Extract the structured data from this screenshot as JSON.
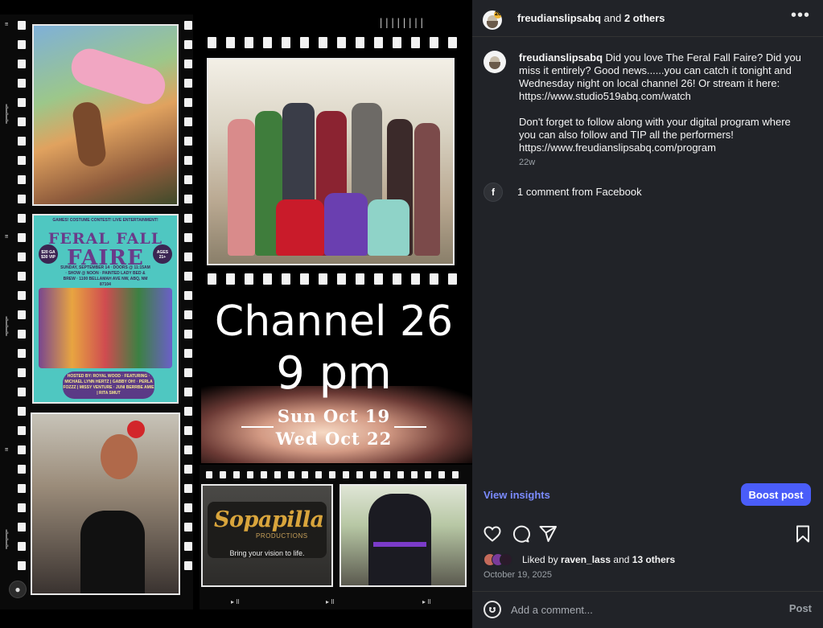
{
  "media": {
    "poster": {
      "header_line": "GAMES! COSTUME CONTEST! LIVE ENTERTAINMENT!",
      "title_line1": "FERAL FALL",
      "title_line2": "FAIRE",
      "price_badge": "$20 GA $30 VIP",
      "age_badge": "AGES 21+",
      "info": "SUNDAY, SEPTEMBER 14 · DOORS @ 11:15AM · SHOW @ NOON · PAINTED LADY BED & BREW · 1100 BELLAMAH AVE NW, ABQ, NM 87104",
      "host": "HOSTED BY: ROYAL WOOD · FEATURING · MICHAEL LYNN HERTZ | GABBY OH! · PERLA FOZZZ | MISSY VENTURE · JUNI BERRBE AMIE | RITA SMUT"
    },
    "channel_title": "Channel 26",
    "time": "9 pm",
    "date1": "Sun Oct 19",
    "date2": "Wed Oct 22",
    "logo_name": "Sopapilla",
    "logo_sub": "PRODUCTIONS",
    "logo_tagline": "Bring your vision to life."
  },
  "header": {
    "username": "freudianslipsabq",
    "and_text": " and ",
    "others": "2 others",
    "more_icon": "more-horizontal-icon",
    "avatar_badge": "26"
  },
  "caption": {
    "username": "freudianslipsabq",
    "paragraph1": " Did you love The Feral Fall Faire? Did you miss it entirely? Good news......you can catch it tonight and Wednesday night on local channel 26! Or stream it here: https://www.studio519abq.com/watch",
    "paragraph2": "Don't forget to follow along with your digital program where you can also follow and TIP all the performers! https://www.freudianslipsabq.com/program",
    "age": "22w"
  },
  "facebook": {
    "icon": "facebook-icon",
    "text": "1 comment from Facebook"
  },
  "insights_label": "View insights",
  "boost_label": "Boost post",
  "actions": {
    "like_icon": "heart-icon",
    "comment_icon": "comment-icon",
    "share_icon": "send-icon",
    "save_icon": "bookmark-icon"
  },
  "likes": {
    "prefix": "Liked by ",
    "user": "raven_lass",
    "middle": " and ",
    "others": "13 others"
  },
  "date": "October 19, 2025",
  "comment": {
    "placeholder": "Add a comment...",
    "post_label": "Post",
    "emoji_icon": "emoji-icon"
  },
  "colors": {
    "panel_bg": "#212328",
    "accent": "#4a5df9",
    "link": "#7b8bff"
  }
}
